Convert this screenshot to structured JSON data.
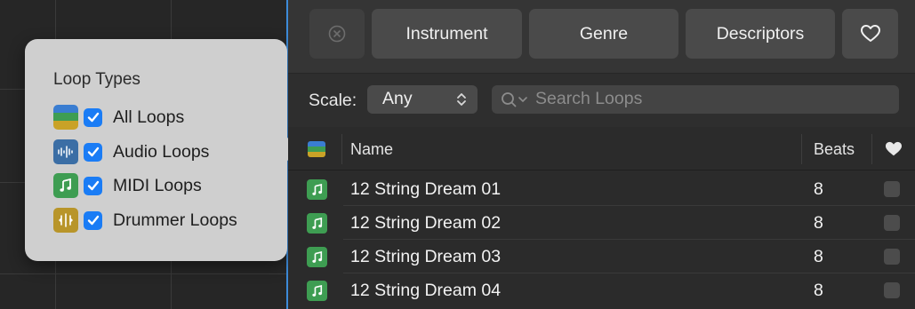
{
  "popover": {
    "title": "Loop Types",
    "items": [
      {
        "label": "All Loops",
        "checked": true,
        "icon": "all-loops-icon"
      },
      {
        "label": "Audio Loops",
        "checked": true,
        "icon": "audio-waveform-icon"
      },
      {
        "label": "MIDI Loops",
        "checked": true,
        "icon": "midi-note-icon"
      },
      {
        "label": "Drummer Loops",
        "checked": true,
        "icon": "drummer-icon"
      }
    ]
  },
  "toolbar": {
    "clear_icon": "clear-icon",
    "instrument": "Instrument",
    "genre": "Genre",
    "descriptors": "Descriptors",
    "favorites_icon": "heart-icon"
  },
  "search": {
    "scale_label": "Scale:",
    "scale_value": "Any",
    "placeholder": "Search Loops"
  },
  "list": {
    "columns": {
      "name": "Name",
      "beats": "Beats"
    },
    "rows": [
      {
        "name": "12 String Dream 01",
        "beats": "8",
        "favorite": false
      },
      {
        "name": "12 String Dream 02",
        "beats": "8",
        "favorite": false
      },
      {
        "name": "12 String Dream 03",
        "beats": "8",
        "favorite": false
      },
      {
        "name": "12 String Dream 04",
        "beats": "8",
        "favorite": false
      }
    ]
  },
  "colors": {
    "accent": "#1a7cf5",
    "playhead": "#3d8bd9",
    "midi_green": "#3e9d52",
    "audio_blue": "#3b6ea5",
    "drummer_gold": "#b8952a"
  }
}
